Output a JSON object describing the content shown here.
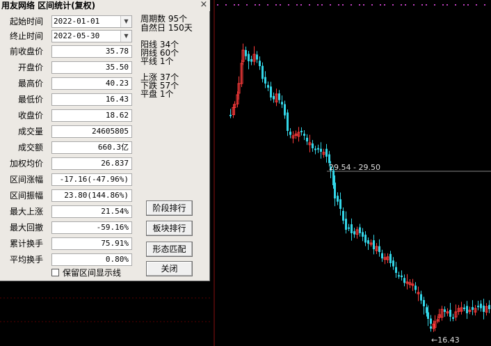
{
  "dialog": {
    "title": "用友网络 区间统计(复权)",
    "close_glyph": "×",
    "start_label": "起始时间",
    "start_value": "2022-01-01",
    "end_label": "终止时间",
    "end_value": "2022-05-30",
    "rows": [
      {
        "label": "前收盘价",
        "value": "35.78"
      },
      {
        "label": "开盘价",
        "value": "35.50"
      },
      {
        "label": "最高价",
        "value": "40.23"
      },
      {
        "label": "最低价",
        "value": "16.43"
      },
      {
        "label": "收盘价",
        "value": "18.62"
      },
      {
        "label": "成交量",
        "value": "24605805"
      },
      {
        "label": "成交额",
        "value": "660.3亿"
      },
      {
        "label": "加权均价",
        "value": "26.837"
      },
      {
        "label": "区间涨幅",
        "value": "-17.16(-47.96%)"
      },
      {
        "label": "区间振幅",
        "value": "23.80(144.86%)"
      },
      {
        "label": "最大上涨",
        "value": "21.54%"
      },
      {
        "label": "最大回撤",
        "value": "-59.16%"
      },
      {
        "label": "累计换手",
        "value": "75.91%"
      },
      {
        "label": "平均换手",
        "value": "0.80%"
      }
    ],
    "stats": {
      "period_count": "周期数  95个",
      "natural_days": "自然日  150天",
      "yang": "阳线  34个",
      "yin": "阴线  60个",
      "flat_line": "平线  1个",
      "up": "上涨  37个",
      "down": "下跌  57个",
      "flat": "平盘  1个"
    },
    "buttons": {
      "stage_rank": "阶段排行",
      "sector_rank": "板块排行",
      "pattern_match": "形态匹配",
      "close": "关闭"
    },
    "checkbox_label": "保留区间显示线",
    "checkbox_checked": false
  },
  "chart": {
    "price_line_label": "29.54 - 29.50",
    "low_label": "←16.43",
    "colors": {
      "up": "#ff3b3b",
      "down": "#33d6e8",
      "bg": "#000000",
      "marker": "#c040c0",
      "guide": "#888888"
    }
  }
}
